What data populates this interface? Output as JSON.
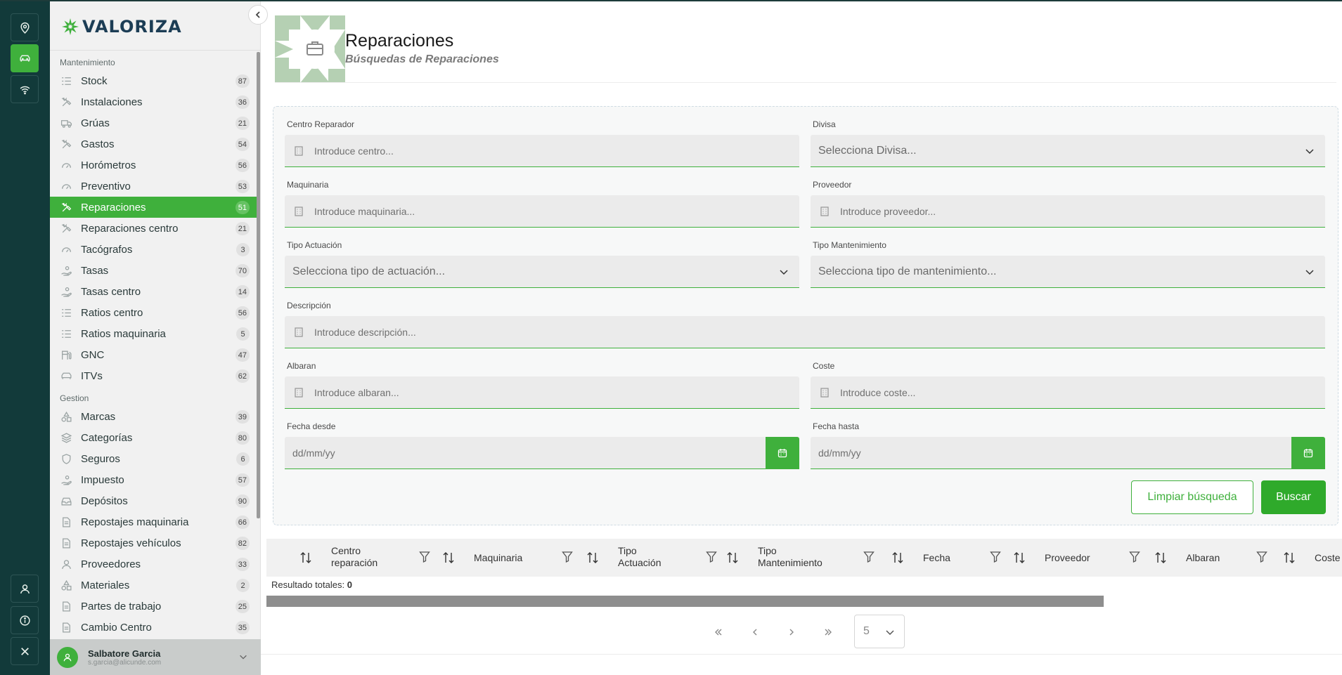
{
  "brand": {
    "name": "VALORIZA",
    "accent": "#3fb03c",
    "rail_bg": "#123a3a"
  },
  "sidebar": {
    "sections": [
      {
        "label": "Mantenimiento",
        "items": [
          {
            "label": "Stock",
            "count": "87",
            "icon": "list-icon"
          },
          {
            "label": "Instalaciones",
            "count": "36",
            "icon": "tools-icon"
          },
          {
            "label": "Grúas",
            "count": "21",
            "icon": "truck-icon"
          },
          {
            "label": "Gastos",
            "count": "54",
            "icon": "tools-icon"
          },
          {
            "label": "Horómetros",
            "count": "56",
            "icon": "gauge-icon"
          },
          {
            "label": "Preventivo",
            "count": "53",
            "icon": "gauge-icon"
          },
          {
            "label": "Reparaciones",
            "count": "51",
            "icon": "tools-icon",
            "active": true
          },
          {
            "label": "Reparaciones centro",
            "count": "21",
            "icon": "tools-icon"
          },
          {
            "label": "Tacógrafos",
            "count": "3",
            "icon": "gauge-icon"
          },
          {
            "label": "Tasas",
            "count": "70",
            "icon": "hand-coin-icon"
          },
          {
            "label": "Tasas centro",
            "count": "14",
            "icon": "hand-coin-icon"
          },
          {
            "label": "Ratios centro",
            "count": "56",
            "icon": "list-icon"
          },
          {
            "label": "Ratios maquinaria",
            "count": "5",
            "icon": "list-icon"
          },
          {
            "label": "GNC",
            "count": "47",
            "icon": "fuel-icon"
          },
          {
            "label": "ITVs",
            "count": "62",
            "icon": "car-icon"
          }
        ]
      },
      {
        "label": "Gestion",
        "items": [
          {
            "label": "Marcas",
            "count": "39",
            "icon": "shapes-icon"
          },
          {
            "label": "Categorías",
            "count": "80",
            "icon": "layers-icon"
          },
          {
            "label": "Seguros",
            "count": "6",
            "icon": "shield-icon"
          },
          {
            "label": "Impuesto",
            "count": "57",
            "icon": "hand-coin-icon"
          },
          {
            "label": "Depósitos",
            "count": "90",
            "icon": "inbox-icon"
          },
          {
            "label": "Repostajes maquinaria",
            "count": "66",
            "icon": "document-icon"
          },
          {
            "label": "Repostajes vehículos",
            "count": "82",
            "icon": "document-icon"
          },
          {
            "label": "Proveedores",
            "count": "33",
            "icon": "user-icon"
          },
          {
            "label": "Materiales",
            "count": "2",
            "icon": "shapes-icon"
          },
          {
            "label": "Partes de trabajo",
            "count": "25",
            "icon": "document-icon"
          },
          {
            "label": "Cambio Centro",
            "count": "35",
            "icon": "document-icon"
          }
        ]
      }
    ],
    "user": {
      "name": "Salbatore Garcia",
      "email": "s.garcia@alicunde.com"
    }
  },
  "header": {
    "title": "Reparaciones",
    "subtitle": "Búsquedas de Reparaciones"
  },
  "form": {
    "centro": {
      "label": "Centro Reparador",
      "placeholder": "Introduce centro..."
    },
    "divisa": {
      "label": "Divisa",
      "placeholder": "Selecciona Divisa..."
    },
    "maquinaria": {
      "label": "Maquinaria",
      "placeholder": "Introduce maquinaria..."
    },
    "proveedor": {
      "label": "Proveedor",
      "placeholder": "Introduce proveedor..."
    },
    "tipo_actuacion": {
      "label": "Tipo Actuación",
      "placeholder": "Selecciona tipo de actuación..."
    },
    "tipo_mantenimiento": {
      "label": "Tipo Mantenimiento",
      "placeholder": "Selecciona tipo de mantenimiento..."
    },
    "descripcion": {
      "label": "Descripción",
      "placeholder": "Introduce descripción..."
    },
    "albaran": {
      "label": "Albaran",
      "placeholder": "Introduce albaran..."
    },
    "coste": {
      "label": "Coste",
      "placeholder": "Introduce coste..."
    },
    "fecha_desde": {
      "label": "Fecha desde",
      "placeholder": "dd/mm/yy"
    },
    "fecha_hasta": {
      "label": "Fecha hasta",
      "placeholder": "dd/mm/yy"
    },
    "clear_label": "Limpiar búsqueda",
    "search_label": "Buscar"
  },
  "table": {
    "columns": [
      {
        "line1": "Centro",
        "line2": "reparación"
      },
      {
        "line1": "Maquinaria",
        "line2": ""
      },
      {
        "line1": "Tipo",
        "line2": "Actuación"
      },
      {
        "line1": "Tipo",
        "line2": "Mantenimiento"
      },
      {
        "line1": "Fecha",
        "line2": ""
      },
      {
        "line1": "Proveedor",
        "line2": ""
      },
      {
        "line1": "Albaran",
        "line2": ""
      },
      {
        "line1": "Coste",
        "line2": ""
      }
    ],
    "result_label": "Resultado totales:",
    "result_count": "0"
  },
  "pagination": {
    "page_size": "5"
  }
}
